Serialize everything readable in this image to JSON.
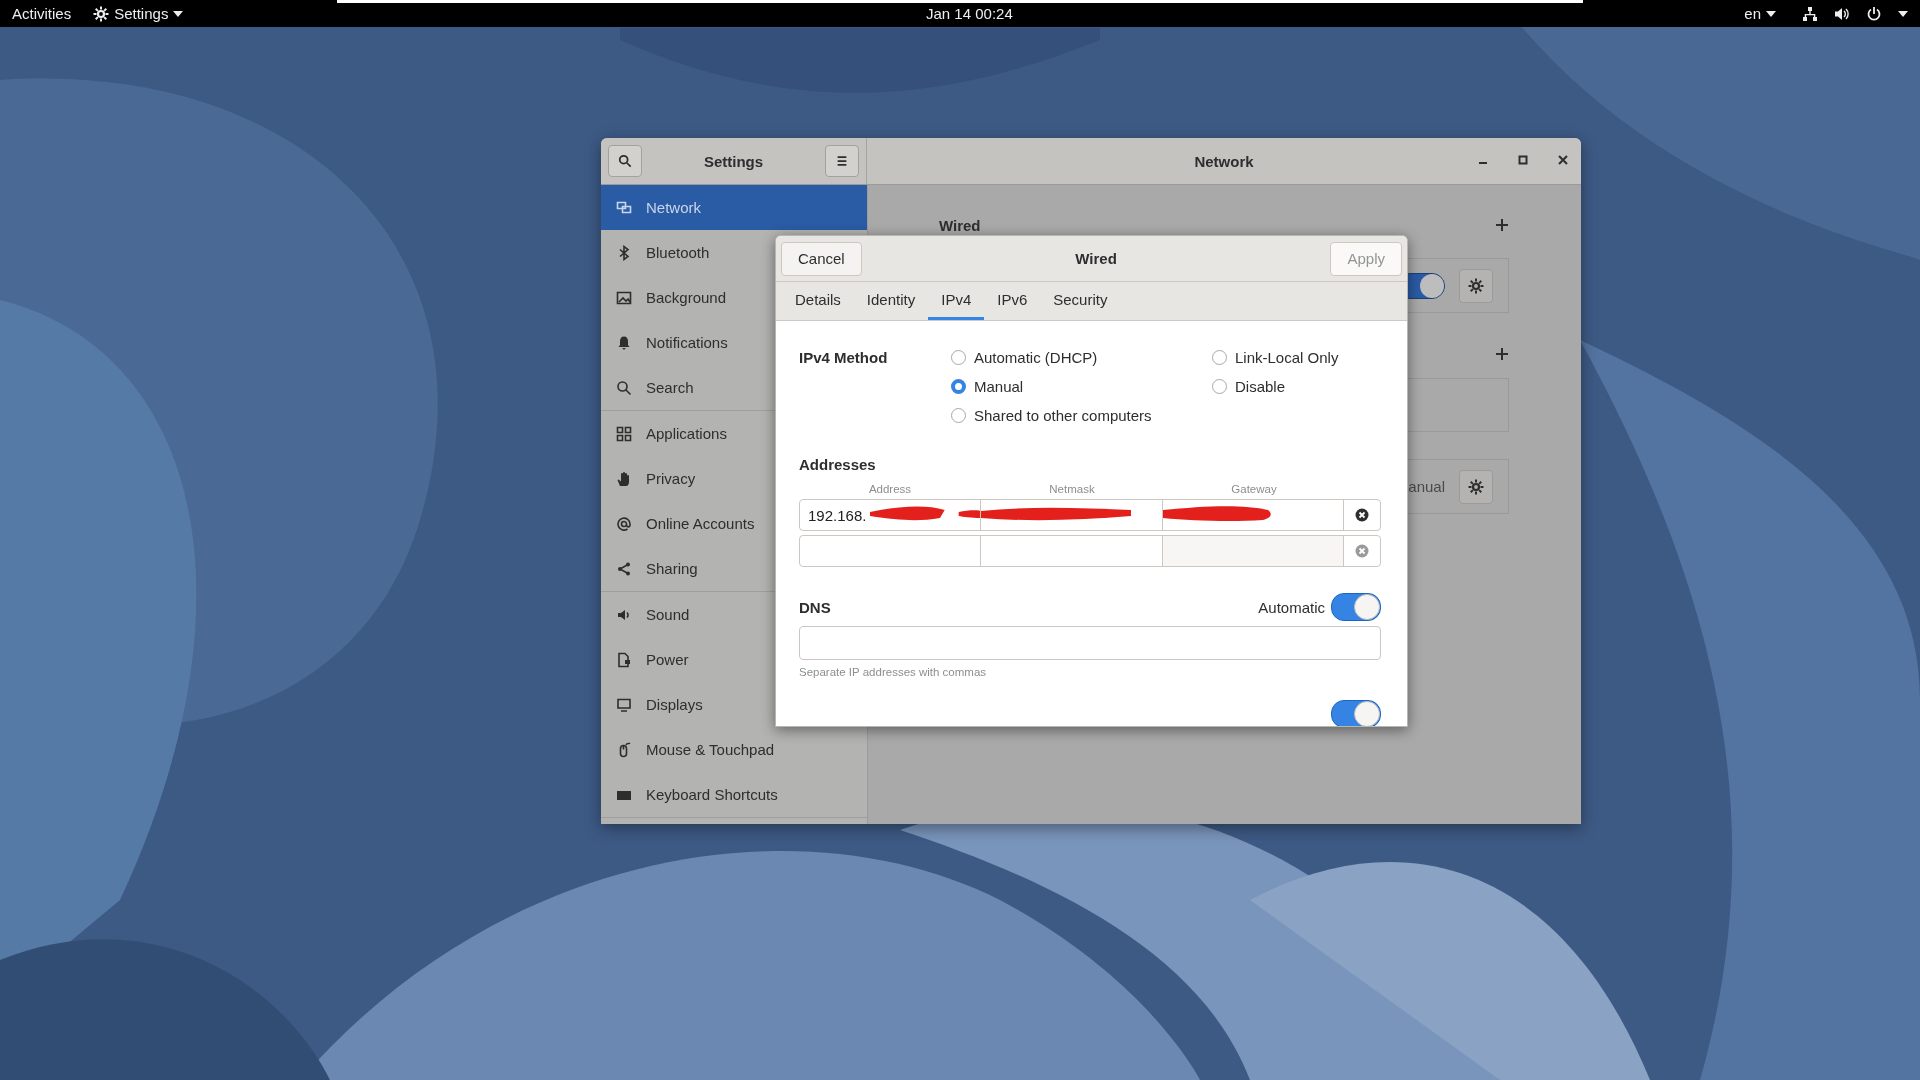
{
  "top_bar": {
    "activities": "Activities",
    "app_menu": "Settings",
    "clock": "Jan 14  00:24",
    "language": "en"
  },
  "settings_window": {
    "sidebar_title": "Settings",
    "title": "Network",
    "sidebar_groups": [
      {
        "items": [
          {
            "label": "Network",
            "selected": true
          },
          {
            "label": "Bluetooth",
            "selected": false
          },
          {
            "label": "Background",
            "selected": false
          },
          {
            "label": "Notifications",
            "selected": false
          },
          {
            "label": "Search",
            "selected": false
          }
        ]
      },
      {
        "items": [
          {
            "label": "Applications",
            "selected": false
          },
          {
            "label": "Privacy",
            "selected": false
          },
          {
            "label": "Online Accounts",
            "selected": false
          },
          {
            "label": "Sharing",
            "selected": false
          }
        ]
      },
      {
        "items": [
          {
            "label": "Sound",
            "selected": false
          },
          {
            "label": "Power",
            "selected": false
          },
          {
            "label": "Displays",
            "selected": false
          },
          {
            "label": "Mouse & Touchpad",
            "selected": false
          },
          {
            "label": "Keyboard Shortcuts",
            "selected": false
          }
        ]
      }
    ]
  },
  "network_panel": {
    "section_title": "Wired",
    "wired_switch": {
      "on": true
    },
    "vpn_text": "anual"
  },
  "dialog": {
    "title": "Wired",
    "cancel": "Cancel",
    "apply": {
      "label": "Apply",
      "disabled": true
    },
    "tabs": [
      {
        "label": "Details",
        "selected": false
      },
      {
        "label": "Identity",
        "selected": false
      },
      {
        "label": "IPv4",
        "selected": true
      },
      {
        "label": "IPv6",
        "selected": false
      },
      {
        "label": "Security",
        "selected": false
      }
    ],
    "ipv4_method": {
      "label": "IPv4 Method",
      "columns": [
        {
          "options": [
            {
              "label": "Automatic (DHCP)",
              "selected": false
            },
            {
              "label": "Manual",
              "selected": true
            },
            {
              "label": "Shared to other computers",
              "selected": false
            }
          ]
        },
        {
          "options": [
            {
              "label": "Link-Local Only",
              "selected": false
            },
            {
              "label": "Disable",
              "selected": false
            }
          ]
        }
      ]
    },
    "addresses": {
      "heading": "Addresses",
      "columns": [
        "Address",
        "Netmask",
        "Gateway"
      ],
      "rows": [
        {
          "address": "192.168.",
          "redacted": true,
          "remove_disabled": false
        },
        {
          "redacted": false,
          "remove_disabled": true
        }
      ]
    },
    "dns": {
      "label": "DNS",
      "auto_label": "Automatic",
      "automatic": true,
      "hint": "Separate IP addresses with commas"
    },
    "routes_switch": {
      "on": true
    }
  }
}
